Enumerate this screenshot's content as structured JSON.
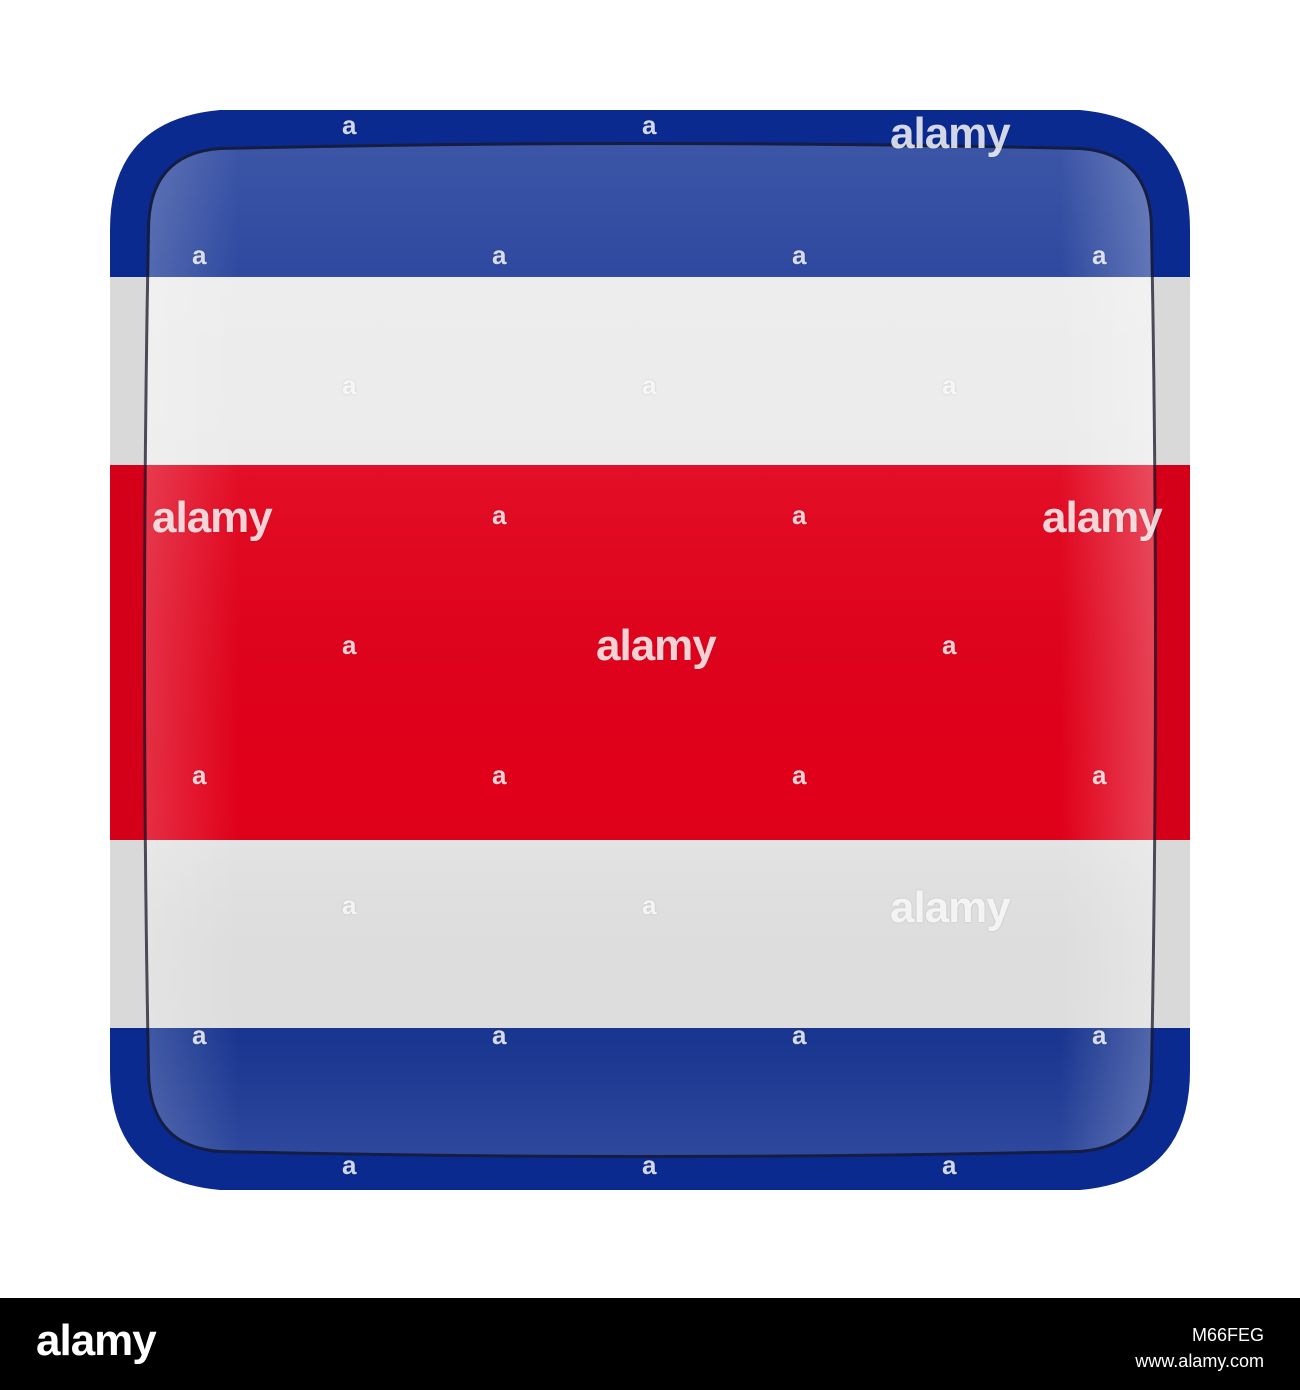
{
  "flag": {
    "name": "costa-rica-flag",
    "colors": {
      "blue": "#0a2a8f",
      "white": "#e8e8e8",
      "red": "#e1001a"
    }
  },
  "watermarks": {
    "center": "alamy",
    "left": "alamy",
    "right": "alamy",
    "top_right": "alamy",
    "bottom_right": "alamy",
    "small_mark": "a"
  },
  "footer": {
    "logo": "alamy",
    "image_id": "M66FEG",
    "site": "www.alamy.com"
  }
}
